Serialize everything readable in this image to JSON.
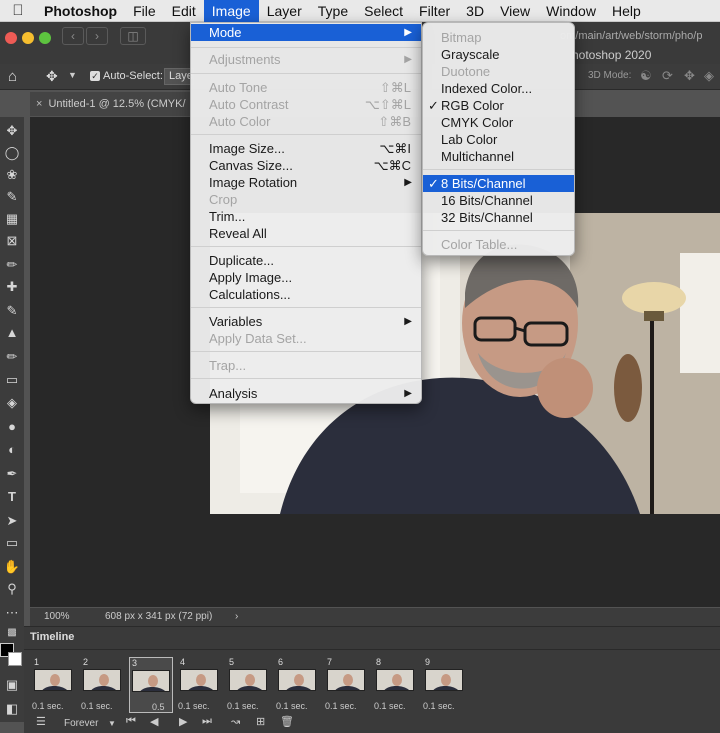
{
  "menubar": {
    "apple_icon": "apple-icon",
    "app_name": "Photoshop",
    "items": [
      "File",
      "Edit",
      "Image",
      "Layer",
      "Type",
      "Select",
      "Filter",
      "3D",
      "View",
      "Window",
      "Help"
    ],
    "active_item": "Image"
  },
  "window": {
    "url_fragment": "om/main/art/web/storm/pho/p",
    "title": "hotoshop 2020"
  },
  "options_bar": {
    "auto_select_label": "Auto-Select:",
    "auto_select_checked": true,
    "layer_value": "Layer",
    "mode_3d_label": "3D Mode:"
  },
  "document": {
    "tab_label": "Untitled-1 @ 12.5% (CMYK/"
  },
  "status_bar": {
    "zoom": "100%",
    "dimensions": "608 px x 341 px (72 ppi)",
    "arrow": "›"
  },
  "timeline": {
    "title": "Timeline",
    "loop": "Forever",
    "selected_frame": 3,
    "frames": [
      {
        "num": "1",
        "duration": "0.1 sec."
      },
      {
        "num": "2",
        "duration": "0.1 sec."
      },
      {
        "num": "3",
        "duration": "0.5"
      },
      {
        "num": "4",
        "duration": "0.1 sec."
      },
      {
        "num": "5",
        "duration": "0.1 sec."
      },
      {
        "num": "6",
        "duration": "0.1 sec."
      },
      {
        "num": "7",
        "duration": "0.1 sec."
      },
      {
        "num": "8",
        "duration": "0.1 sec."
      },
      {
        "num": "9",
        "duration": "0.1 sec."
      }
    ]
  },
  "image_menu": {
    "mode": "Mode",
    "adjustments": "Adjustments",
    "auto_tone": "Auto Tone",
    "auto_tone_sc": "⇧⌘L",
    "auto_contrast": "Auto Contrast",
    "auto_contrast_sc": "⌥⇧⌘L",
    "auto_color": "Auto Color",
    "auto_color_sc": "⇧⌘B",
    "image_size": "Image Size...",
    "image_size_sc": "⌥⌘I",
    "canvas_size": "Canvas Size...",
    "canvas_size_sc": "⌥⌘C",
    "image_rotation": "Image Rotation",
    "crop": "Crop",
    "trim": "Trim...",
    "reveal_all": "Reveal All",
    "duplicate": "Duplicate...",
    "apply_image": "Apply Image...",
    "calculations": "Calculations...",
    "variables": "Variables",
    "apply_data_set": "Apply Data Set...",
    "trap": "Trap...",
    "analysis": "Analysis"
  },
  "mode_menu": {
    "bitmap": "Bitmap",
    "grayscale": "Grayscale",
    "duotone": "Duotone",
    "indexed_color": "Indexed Color...",
    "rgb_color": "RGB Color",
    "cmyk_color": "CMYK Color",
    "lab_color": "Lab Color",
    "multichannel": "Multichannel",
    "bits8": "8 Bits/Channel",
    "bits16": "16 Bits/Channel",
    "bits32": "32 Bits/Channel",
    "color_table": "Color Table...",
    "checked_mode": "RGB Color",
    "checked_depth": "8 Bits/Channel"
  },
  "colors": {
    "highlight": "#1960d6",
    "panel": "#3c3c3c",
    "canvas": "#282828"
  }
}
